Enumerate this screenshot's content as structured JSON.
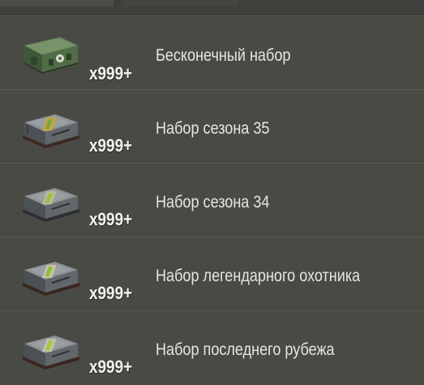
{
  "items": [
    {
      "name": "Бесконечный набор",
      "count": "x999+",
      "icon": "green-supply-crate-icon",
      "icon_color": "#4f6b47"
    },
    {
      "name": "Набор сезона 35",
      "count": "x999+",
      "icon": "season-crate-icon",
      "icon_color": "#6d7378"
    },
    {
      "name": "Набор сезона 34",
      "count": "x999+",
      "icon": "season-crate-icon",
      "icon_color": "#6d7378"
    },
    {
      "name": "Набор легендарного охотника",
      "count": "x999+",
      "icon": "season-crate-icon",
      "icon_color": "#6d7378"
    },
    {
      "name": "Набор последнего рубежа",
      "count": "x999+",
      "icon": "season-crate-icon",
      "icon_color": "#6d7378"
    }
  ]
}
